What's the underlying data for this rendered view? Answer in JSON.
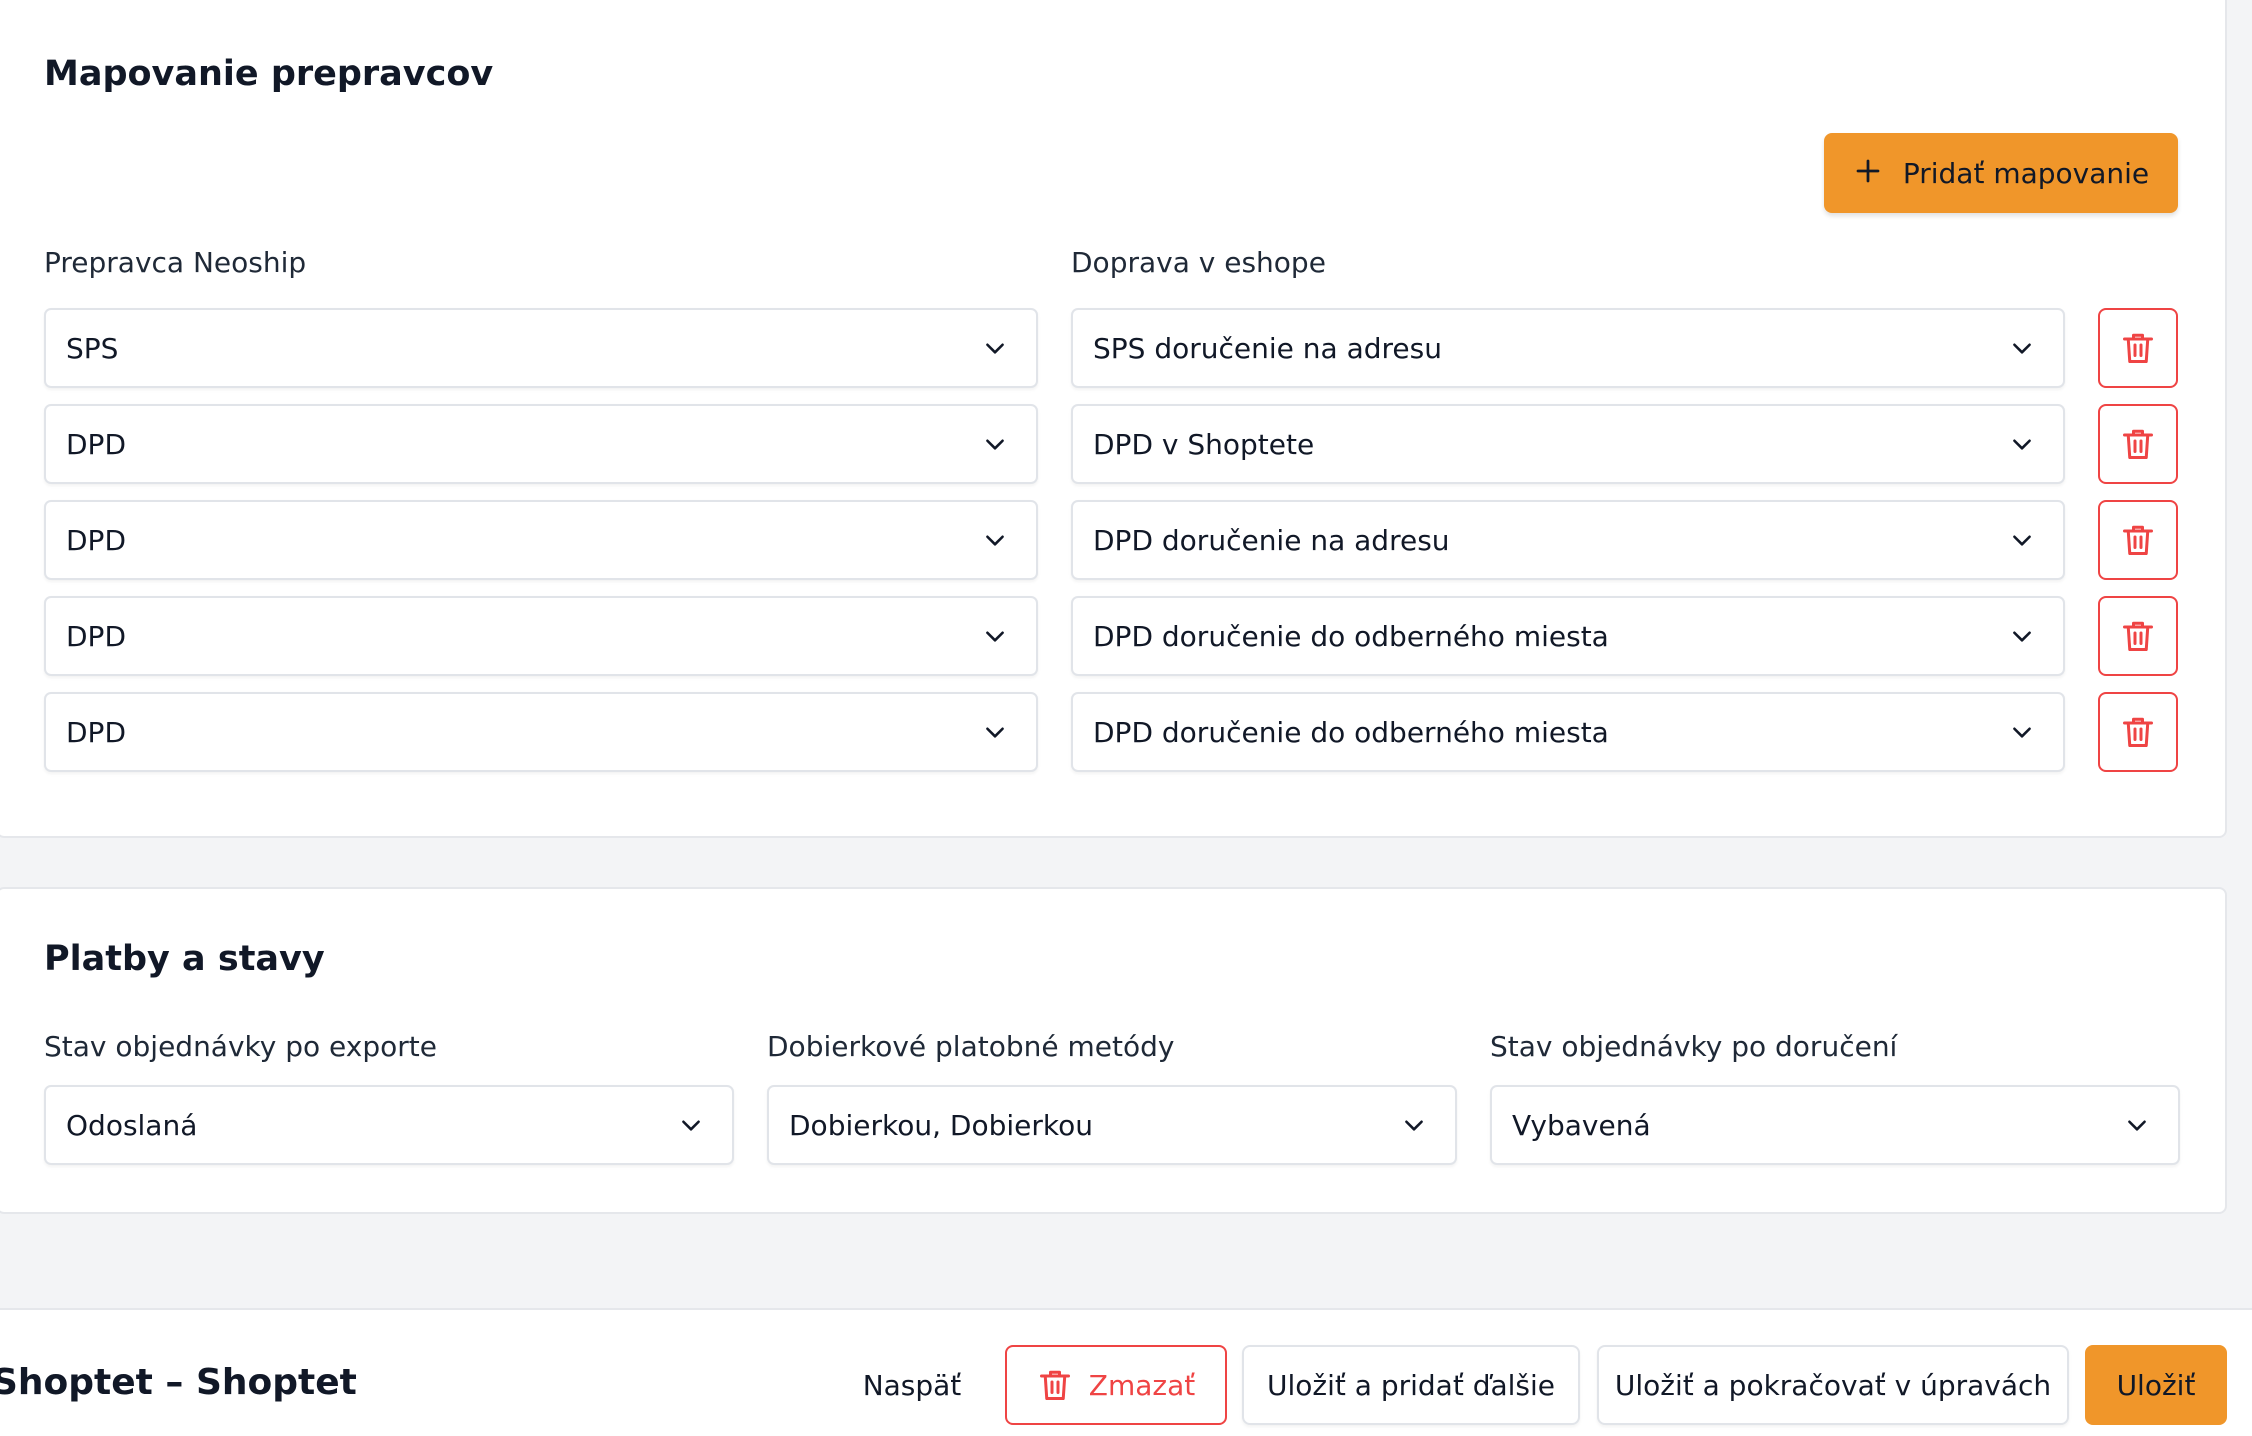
{
  "carriers": {
    "title": "Mapovanie prepravcov",
    "add_button": "Pridať mapovanie",
    "col_carrier": "Prepravca Neoship",
    "col_shipping": "Doprava v eshope",
    "rows": [
      {
        "carrier": "SPS",
        "shipping": "SPS doručenie na adresu"
      },
      {
        "carrier": "DPD",
        "shipping": "DPD v Shoptete"
      },
      {
        "carrier": "DPD",
        "shipping": "DPD doručenie na adresu"
      },
      {
        "carrier": "DPD",
        "shipping": "DPD doručenie do odberného miesta"
      },
      {
        "carrier": "DPD",
        "shipping": "DPD doručenie do odberného miesta"
      }
    ]
  },
  "payments": {
    "title": "Platby a stavy",
    "fields": [
      {
        "label": "Stav objednávky po exporte",
        "value": "Odoslaná"
      },
      {
        "label": "Dobierkové platobné metódy",
        "value": "Dobierkou, Dobierkou"
      },
      {
        "label": "Stav objednávky po doručení",
        "value": "Vybavená"
      }
    ]
  },
  "footer": {
    "title": "Shoptet – Shoptet",
    "back": "Naspäť",
    "delete": "Zmazať",
    "save_add": "Uložiť a pridať ďalšie",
    "save_continue": "Uložiť a pokračovať v úpravách",
    "save": "Uložiť"
  },
  "colors": {
    "accent": "#f0962a",
    "danger": "#ef4444",
    "background": "#f3f4f6"
  }
}
